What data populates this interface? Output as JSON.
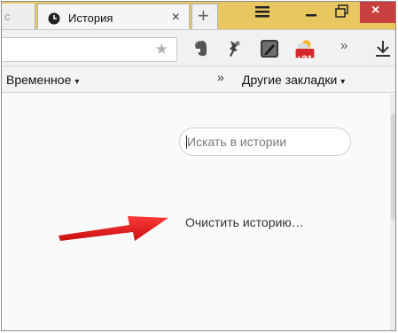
{
  "tabs": {
    "partial_left_label": "c",
    "active": {
      "title": "История",
      "icon": "clock-icon",
      "close_label": "×"
    },
    "new_tab_label": "+"
  },
  "window": {
    "menu_icon": "hamburger-icon",
    "minimize_icon": "minimize-icon",
    "maximize_icon": "restore-icon",
    "close_label": "×"
  },
  "toolbar": {
    "bookmark_star": "★",
    "extensions": [
      "evernote-icon",
      "bulb-icon",
      "pen-icon",
      "weather-icon"
    ],
    "weather_badge": "+31",
    "overflow_label": "»",
    "download_icon": "download-icon"
  },
  "bookmarks": {
    "left": {
      "label": "Временное",
      "caret": "▾"
    },
    "chevron": "»",
    "other": {
      "label": "Другие закладки",
      "caret": "▾"
    }
  },
  "history_page": {
    "search_placeholder": "Искать в истории",
    "clear_history_label": "Очистить историю…"
  },
  "colors": {
    "tabstrip": "#e8c760",
    "close_button": "#c94040",
    "arrow": "#e01f1f"
  }
}
